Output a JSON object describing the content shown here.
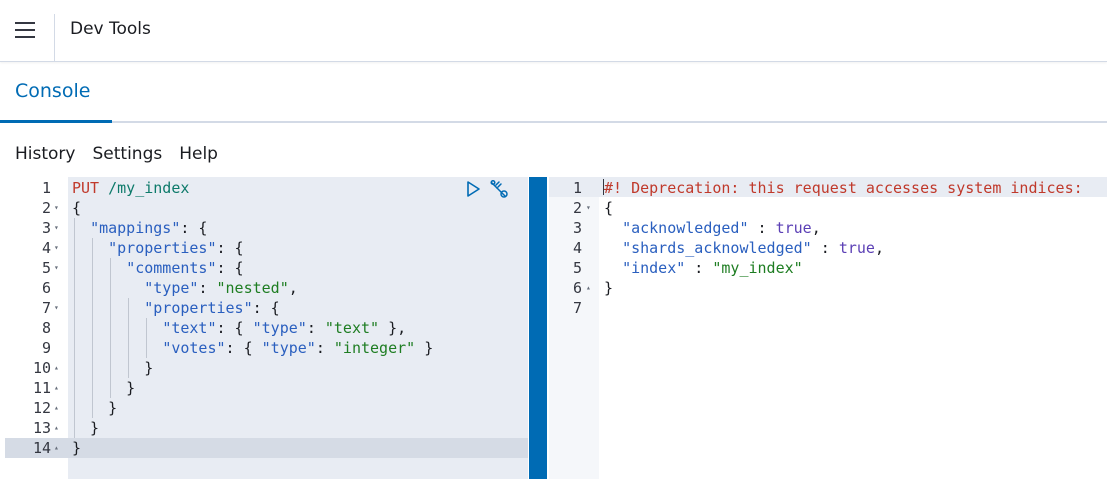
{
  "header": {
    "title": "Dev Tools"
  },
  "tabs": [
    {
      "label": "Console",
      "active": true
    }
  ],
  "menu": {
    "history": "History",
    "settings": "Settings",
    "help": "Help"
  },
  "request_editor": {
    "line_numbers": [
      "1",
      "2",
      "3",
      "4",
      "5",
      "6",
      "7",
      "8",
      "9",
      "10",
      "11",
      "12",
      "13",
      "14"
    ],
    "fold_markers": [
      "",
      "▾",
      "▾",
      "▾",
      "▾",
      "",
      "▾",
      "",
      "",
      "▴",
      "▴",
      "▴",
      "▴",
      "▴"
    ],
    "lines": [
      [
        {
          "t": "PUT",
          "c": "m"
        },
        {
          "t": " ",
          "c": ""
        },
        {
          "t": "/my_index",
          "c": "u"
        }
      ],
      [
        {
          "t": "{",
          "c": ""
        }
      ],
      [
        {
          "t": "  ",
          "c": ""
        },
        {
          "t": "\"mappings\"",
          "c": "k"
        },
        {
          "t": ": {",
          "c": ""
        }
      ],
      [
        {
          "t": "    ",
          "c": ""
        },
        {
          "t": "\"properties\"",
          "c": "k"
        },
        {
          "t": ": {",
          "c": ""
        }
      ],
      [
        {
          "t": "      ",
          "c": ""
        },
        {
          "t": "\"comments\"",
          "c": "k"
        },
        {
          "t": ": {",
          "c": ""
        }
      ],
      [
        {
          "t": "        ",
          "c": ""
        },
        {
          "t": "\"type\"",
          "c": "k"
        },
        {
          "t": ": ",
          "c": ""
        },
        {
          "t": "\"nested\"",
          "c": "s"
        },
        {
          "t": ",",
          "c": ""
        }
      ],
      [
        {
          "t": "        ",
          "c": ""
        },
        {
          "t": "\"properties\"",
          "c": "k"
        },
        {
          "t": ": {",
          "c": ""
        }
      ],
      [
        {
          "t": "          ",
          "c": ""
        },
        {
          "t": "\"text\"",
          "c": "k"
        },
        {
          "t": ": { ",
          "c": ""
        },
        {
          "t": "\"type\"",
          "c": "k"
        },
        {
          "t": ": ",
          "c": ""
        },
        {
          "t": "\"text\"",
          "c": "s"
        },
        {
          "t": " },",
          "c": ""
        }
      ],
      [
        {
          "t": "          ",
          "c": ""
        },
        {
          "t": "\"votes\"",
          "c": "k"
        },
        {
          "t": ": { ",
          "c": ""
        },
        {
          "t": "\"type\"",
          "c": "k"
        },
        {
          "t": ": ",
          "c": ""
        },
        {
          "t": "\"integer\"",
          "c": "s"
        },
        {
          "t": " }",
          "c": ""
        }
      ],
      [
        {
          "t": "        }",
          "c": ""
        }
      ],
      [
        {
          "t": "      }",
          "c": ""
        }
      ],
      [
        {
          "t": "    }",
          "c": ""
        }
      ],
      [
        {
          "t": "  }",
          "c": ""
        }
      ],
      [
        {
          "t": "}",
          "c": ""
        }
      ]
    ]
  },
  "response_viewer": {
    "line_numbers": [
      "1",
      "2",
      "3",
      "4",
      "5",
      "6",
      "7"
    ],
    "fold_markers": [
      "",
      "▾",
      "",
      "",
      "",
      "▴",
      ""
    ],
    "lines": [
      [
        {
          "t": "#! Deprecation: this request accesses system indices:",
          "c": "m"
        }
      ],
      [
        {
          "t": "{",
          "c": ""
        }
      ],
      [
        {
          "t": "  ",
          "c": ""
        },
        {
          "t": "\"acknowledged\"",
          "c": "k"
        },
        {
          "t": " : ",
          "c": ""
        },
        {
          "t": "true",
          "c": "b"
        },
        {
          "t": ",",
          "c": ""
        }
      ],
      [
        {
          "t": "  ",
          "c": ""
        },
        {
          "t": "\"shards_acknowledged\"",
          "c": "k"
        },
        {
          "t": " : ",
          "c": ""
        },
        {
          "t": "true",
          "c": "b"
        },
        {
          "t": ",",
          "c": ""
        }
      ],
      [
        {
          "t": "  ",
          "c": ""
        },
        {
          "t": "\"index\"",
          "c": "k"
        },
        {
          "t": " : ",
          "c": ""
        },
        {
          "t": "\"my_index\"",
          "c": "s"
        }
      ],
      [
        {
          "t": "}",
          "c": ""
        }
      ],
      [
        {
          "t": "",
          "c": ""
        }
      ]
    ]
  },
  "colors": {
    "accent": "#006bb4",
    "string": "#1e7d22",
    "key": "#2a5fbf",
    "method": "#c0392b",
    "boolean": "#5b3fb5"
  },
  "icons": {
    "menu": "hamburger-icon",
    "run": "play-icon",
    "settings": "wrench-icon"
  }
}
